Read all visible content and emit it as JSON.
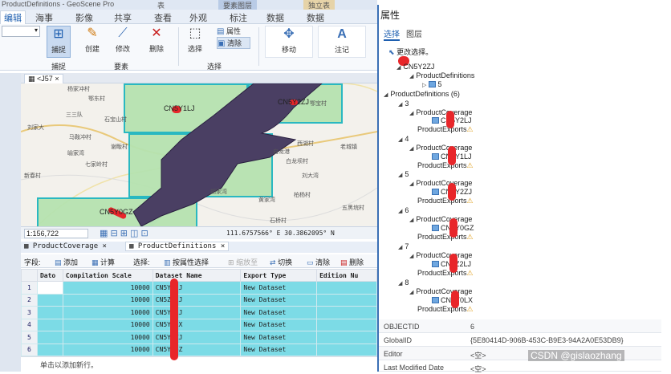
{
  "title_bar": {
    "title": "ProductDefinitions - GeoScene Pro",
    "ctx_left": "表",
    "ctx_mid": "要素图层",
    "ctx_right": "独立表"
  },
  "ribbon_tabs": [
    "编辑",
    "海事",
    "影像",
    "共享",
    "查看",
    "外观",
    "标注",
    "数据",
    "数据"
  ],
  "ribbon": {
    "buttons": [
      {
        "label": "捕捉",
        "icon": "snap-icon"
      },
      {
        "label": "创建",
        "icon": "create-icon"
      },
      {
        "label": "修改",
        "icon": "modify-icon"
      },
      {
        "label": "删除",
        "icon": "delete-icon"
      },
      {
        "label": "选择",
        "icon": "select-icon"
      },
      {
        "label": "属性",
        "icon": "attributes-icon"
      },
      {
        "label": "清除",
        "icon": "clear-icon"
      },
      {
        "label": "移动",
        "icon": "move-icon"
      },
      {
        "label": "注记",
        "icon": "annotate-icon"
      }
    ],
    "groups": [
      "捕捉",
      "要素",
      "选择"
    ]
  },
  "map_view": {
    "tab": "<J57"
  },
  "map": {
    "cells": [
      "CN5Y2LJ",
      "CN5Y2ZJ",
      "CN5Y0GZ",
      "CN5Y1LJ"
    ],
    "places": [
      "杨家冲村",
      "鄂东村",
      "三三队",
      "石宝山村",
      "刘家大",
      "马鞍冲村",
      "谢畈村",
      "喻家湾",
      "七家岭村",
      "西湖村",
      "自龙港",
      "白龙坝村",
      "刘大湾",
      "鄂宝村",
      "老城镇",
      "柏杨村",
      "黄家湾",
      "石桥村",
      "五黑垸村",
      "新春村",
      "胡家湾"
    ]
  },
  "status": {
    "scale": "1:156,722",
    "coords": "111.6757566° E 30.3862095° N"
  },
  "table_tabs": [
    "ProductCoverage",
    "ProductDefinitions"
  ],
  "table_toolbar": {
    "field_label": "字段:",
    "add": "添加",
    "calc": "计算",
    "select_label": "选择:",
    "by_attr": "按属性选择",
    "zoom": "缩放至",
    "switch": "切换",
    "clear": "清除",
    "delete": "删除"
  },
  "table": {
    "columns": [
      "Dato",
      "Compilation Scale",
      "Dataset Name",
      "Export Type",
      "Edition Nu"
    ],
    "rows": [
      {
        "n": "1",
        "scale": "10000",
        "name": "CN5Y2LJ",
        "type": "New Dataset"
      },
      {
        "n": "2",
        "scale": "10000",
        "name": "CN5Z2LJ",
        "type": "New Dataset"
      },
      {
        "n": "3",
        "scale": "10000",
        "name": "CN5Y1LJ",
        "type": "New Dataset"
      },
      {
        "n": "4",
        "scale": "10000",
        "name": "CN5Y0LX",
        "type": "New Dataset"
      },
      {
        "n": "5",
        "scale": "10000",
        "name": "CN5Y2ZJ",
        "type": "New Dataset"
      },
      {
        "n": "6",
        "scale": "10000",
        "name": "CN5Y0GZ",
        "type": "New Dataset"
      }
    ],
    "add_row_hint": "单击以添加新行。"
  },
  "props": {
    "title": "属性",
    "tab_select": "选择",
    "tab_layer": "图层",
    "change_select": "更改选择。",
    "tree": {
      "root": "CN5Y2ZJ",
      "child_pd": "ProductDefinitions",
      "child_num": "5",
      "group": "ProductDefinitions (6)",
      "items": [
        {
          "num": "3",
          "cov": "ProductCoverage",
          "cell": "CN5Y2LJ",
          "exp": "ProductExports"
        },
        {
          "num": "4",
          "cov": "ProductCoverage",
          "cell": "CN5Y1LJ",
          "exp": "ProductExports"
        },
        {
          "num": "5",
          "cov": "ProductCoverage",
          "cell": "CN5Y2ZJ",
          "exp": "ProductExports"
        },
        {
          "num": "6",
          "cov": "ProductCoverage",
          "cell": "CN5Y0GZ",
          "exp": "ProductExports"
        },
        {
          "num": "7",
          "cov": "ProductCoverage",
          "cell": "CN5Z2LJ",
          "exp": "ProductExports"
        },
        {
          "num": "8",
          "cov": "ProductCoverage",
          "cell": "CN5Y0LX",
          "exp": "ProductExports"
        }
      ]
    },
    "attributes": [
      {
        "k": "OBJECTID",
        "v": "6"
      },
      {
        "k": "GlobalID",
        "v": "{5E80414D-906B-453C-B9E3-94A2A0E53DB9}"
      },
      {
        "k": "Editor",
        "v": "<空>"
      },
      {
        "k": "Last Modified Date",
        "v": "<空>"
      }
    ]
  },
  "watermark": "CSDN @gislaozhang"
}
